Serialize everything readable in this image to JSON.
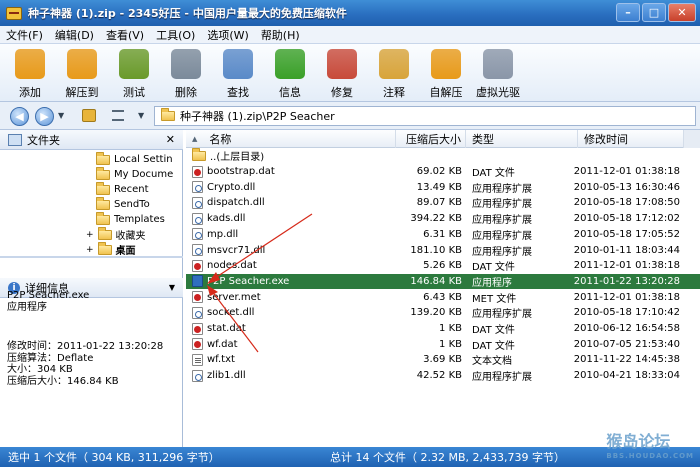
{
  "window": {
    "title": "种子神器 (1).zip - 2345好压 - 中国用户量最大的免费压缩软件"
  },
  "menu": [
    "文件(F)",
    "编辑(D)",
    "查看(V)",
    "工具(O)",
    "选项(W)",
    "帮助(H)"
  ],
  "toolbar": [
    {
      "label": "添加",
      "icon": "add-icon",
      "color": "#e89a1a"
    },
    {
      "label": "解压到",
      "icon": "extract-icon",
      "color": "#e89a1a"
    },
    {
      "label": "测试",
      "icon": "test-icon",
      "color": "#6a9a2a"
    },
    {
      "label": "删除",
      "icon": "delete-icon",
      "color": "#7b8a9a"
    },
    {
      "label": "查找",
      "icon": "find-icon",
      "color": "#5a8ac8"
    },
    {
      "label": "信息",
      "icon": "info-icon",
      "color": "#3aa028"
    },
    {
      "label": "修复",
      "icon": "repair-icon",
      "color": "#c84a3a"
    },
    {
      "label": "注释",
      "icon": "comment-icon",
      "color": "#d8a43a"
    },
    {
      "label": "自解压",
      "icon": "sfx-icon",
      "color": "#e89a1a"
    },
    {
      "label": "虚拟光驱",
      "icon": "virtual-drive-icon",
      "color": "#8a96a8"
    }
  ],
  "address": {
    "path": "种子神器 (1).zip\\P2P Seacher"
  },
  "left": {
    "folders_title": "文件夹",
    "tree": [
      "Local Settin",
      "My Docume",
      "Recent",
      "SendTo",
      "Templates",
      "收藏夹",
      "桌面"
    ],
    "details_title": "详细信息",
    "details": {
      "name": "P2P Seacher.exe",
      "type": "应用程序",
      "modified": "修改时间：2011-01-22 13:20:28",
      "method": "压缩算法：Deflate",
      "size": "大小：304 KB",
      "packed": "压缩后大小：146.84 KB"
    }
  },
  "columns": {
    "name": "名称",
    "packed": "压缩后大小",
    "type": "类型",
    "modified": "修改时间"
  },
  "files": [
    {
      "name": "..(上层目录)",
      "packed": "",
      "type": "",
      "modified": "",
      "kind": "folder"
    },
    {
      "name": "bootstrap.dat",
      "packed": "69.02 KB",
      "type": "DAT 文件",
      "modified": "2011-12-01 01:38:18",
      "kind": "dat"
    },
    {
      "name": "Crypto.dll",
      "packed": "13.49 KB",
      "type": "应用程序扩展",
      "modified": "2010-05-13 16:30:46",
      "kind": "dll"
    },
    {
      "name": "dispatch.dll",
      "packed": "89.07 KB",
      "type": "应用程序扩展",
      "modified": "2010-05-18 17:08:50",
      "kind": "dll"
    },
    {
      "name": "kads.dll",
      "packed": "394.22 KB",
      "type": "应用程序扩展",
      "modified": "2010-05-18 17:12:02",
      "kind": "dll"
    },
    {
      "name": "mp.dll",
      "packed": "6.31 KB",
      "type": "应用程序扩展",
      "modified": "2010-05-18 17:05:52",
      "kind": "dll"
    },
    {
      "name": "msvcr71.dll",
      "packed": "181.10 KB",
      "type": "应用程序扩展",
      "modified": "2010-01-11 18:03:44",
      "kind": "dll"
    },
    {
      "name": "nodes.dat",
      "packed": "5.26 KB",
      "type": "DAT 文件",
      "modified": "2011-12-01 01:38:18",
      "kind": "dat"
    },
    {
      "name": "P2P Seacher.exe",
      "packed": "146.84 KB",
      "type": "应用程序",
      "modified": "2011-01-22 13:20:28",
      "kind": "exe",
      "selected": true
    },
    {
      "name": "server.met",
      "packed": "6.43 KB",
      "type": "MET 文件",
      "modified": "2011-12-01 01:38:18",
      "kind": "dat"
    },
    {
      "name": "socket.dll",
      "packed": "139.20 KB",
      "type": "应用程序扩展",
      "modified": "2010-05-18 17:10:42",
      "kind": "dll"
    },
    {
      "name": "stat.dat",
      "packed": "1 KB",
      "type": "DAT 文件",
      "modified": "2010-06-12 16:54:58",
      "kind": "dat"
    },
    {
      "name": "wf.dat",
      "packed": "1 KB",
      "type": "DAT 文件",
      "modified": "2010-07-05 21:53:40",
      "kind": "dat"
    },
    {
      "name": "wf.txt",
      "packed": "3.69 KB",
      "type": "文本文档",
      "modified": "2011-11-22 14:45:38",
      "kind": "txt"
    },
    {
      "name": "zlib1.dll",
      "packed": "42.52 KB",
      "type": "应用程序扩展",
      "modified": "2010-04-21 18:33:04",
      "kind": "dll"
    }
  ],
  "status": {
    "left": "选中 1 个文件（ 304 KB, 311,296 字节）",
    "right": "总计 14 个文件（ 2.32 MB, 2,433,739 字节）"
  },
  "watermark": {
    "text": "猴岛论坛",
    "url": "BBS.HOUDAO.COM"
  }
}
